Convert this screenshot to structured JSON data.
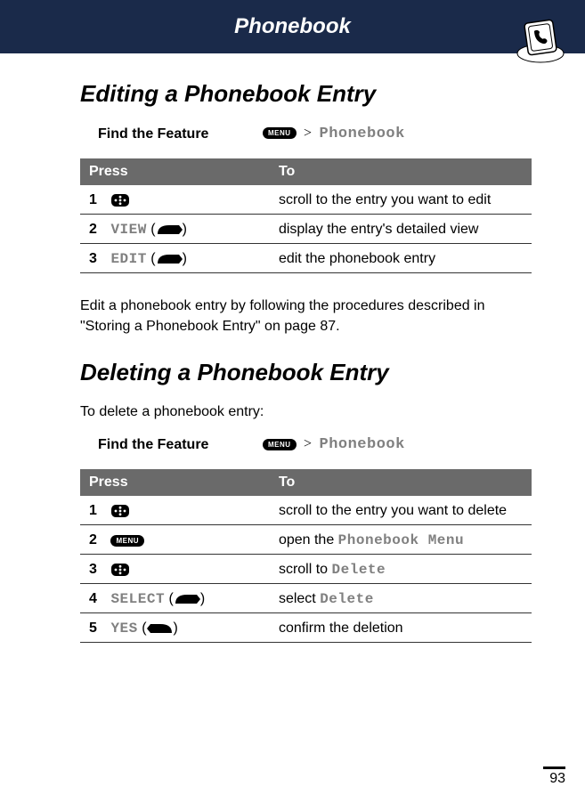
{
  "header": {
    "title": "Phonebook"
  },
  "section1": {
    "title": "Editing a Phonebook Entry",
    "findFeature": {
      "label": "Find the Feature",
      "menuKey": "MENU",
      "path": "Phonebook"
    },
    "table": {
      "headPress": "Press",
      "headTo": "To",
      "rows": [
        {
          "num": "1",
          "press": "",
          "to": "scroll to the entry you want to edit"
        },
        {
          "num": "2",
          "press": "VIEW",
          "to": "display the entry's detailed view"
        },
        {
          "num": "3",
          "press": "EDIT",
          "to": "edit the phonebook entry"
        }
      ]
    },
    "body": "Edit a phonebook entry by following the procedures described in \"Storing a Phonebook Entry\" on page 87."
  },
  "section2": {
    "title": "Deleting a Phonebook Entry",
    "intro": "To delete a phonebook entry:",
    "findFeature": {
      "label": "Find the Feature",
      "menuKey": "MENU",
      "path": "Phonebook"
    },
    "table": {
      "headPress": "Press",
      "headTo": "To",
      "rows": [
        {
          "num": "1",
          "to": "scroll to the entry you want to delete"
        },
        {
          "num": "2",
          "toPrefix": "open the ",
          "toMono": "Phonebook Menu"
        },
        {
          "num": "3",
          "toPrefix": "scroll to ",
          "toMono": "Delete"
        },
        {
          "num": "4",
          "press": "SELECT",
          "toPrefix": "select ",
          "toMono": "Delete"
        },
        {
          "num": "5",
          "press": "YES",
          "to": "confirm the deletion"
        }
      ]
    }
  },
  "pageNumber": "93"
}
